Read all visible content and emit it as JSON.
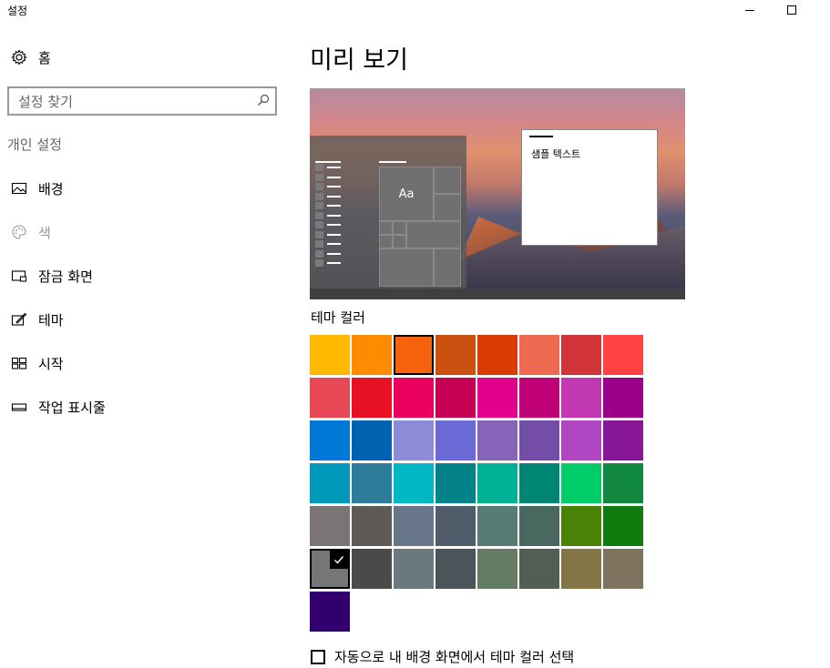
{
  "window": {
    "title": "설정"
  },
  "sidebar": {
    "home_label": "홈",
    "search_placeholder": "설정 찾기",
    "section_label": "개인 설정",
    "items": [
      {
        "label": "배경",
        "icon": "picture-icon"
      },
      {
        "label": "색",
        "icon": "palette-icon"
      },
      {
        "label": "잠금 화면",
        "icon": "lock-screen-icon"
      },
      {
        "label": "테마",
        "icon": "theme-brush-icon"
      },
      {
        "label": "시작",
        "icon": "start-grid-icon"
      },
      {
        "label": "작업 표시줄",
        "icon": "taskbar-icon"
      }
    ]
  },
  "main": {
    "heading": "미리 보기",
    "preview": {
      "tile_text": "Aa",
      "sample_text": "샘플 텍스트"
    },
    "theme_color_label": "테마 컬러",
    "auto_pick_label": "자동으로 내 배경 화면에서 테마 컬러 선택",
    "auto_pick_checked": false
  },
  "colors": {
    "swatches": [
      [
        "#FFB900",
        "#FF8C00",
        "#F7630C",
        "#CA5010",
        "#DA3B01",
        "#EF6950",
        "#D13438",
        "#FF4343"
      ],
      [
        "#E74856",
        "#E81123",
        "#EA005E",
        "#C30052",
        "#E3008C",
        "#BF0077",
        "#C239B3",
        "#9A0089"
      ],
      [
        "#0078D7",
        "#0063B1",
        "#8E8CD8",
        "#6B69D6",
        "#8764B8",
        "#744DA9",
        "#B146C2",
        "#881798"
      ],
      [
        "#0099BC",
        "#2D7D9A",
        "#00B7C3",
        "#038387",
        "#00B294",
        "#018574",
        "#00CC6A",
        "#10893E"
      ],
      [
        "#7A7574",
        "#5D5A58",
        "#68768A",
        "#515C6B",
        "#567C73",
        "#486860",
        "#498205",
        "#107C10"
      ],
      [
        "#767676",
        "#4C4A48",
        "#69797E",
        "#4A5459",
        "#647C64",
        "#525E54",
        "#847545",
        "#7E735F"
      ],
      [
        "#32006E"
      ]
    ],
    "selected_outline": "#F7630C",
    "checked_color": "#767676"
  }
}
